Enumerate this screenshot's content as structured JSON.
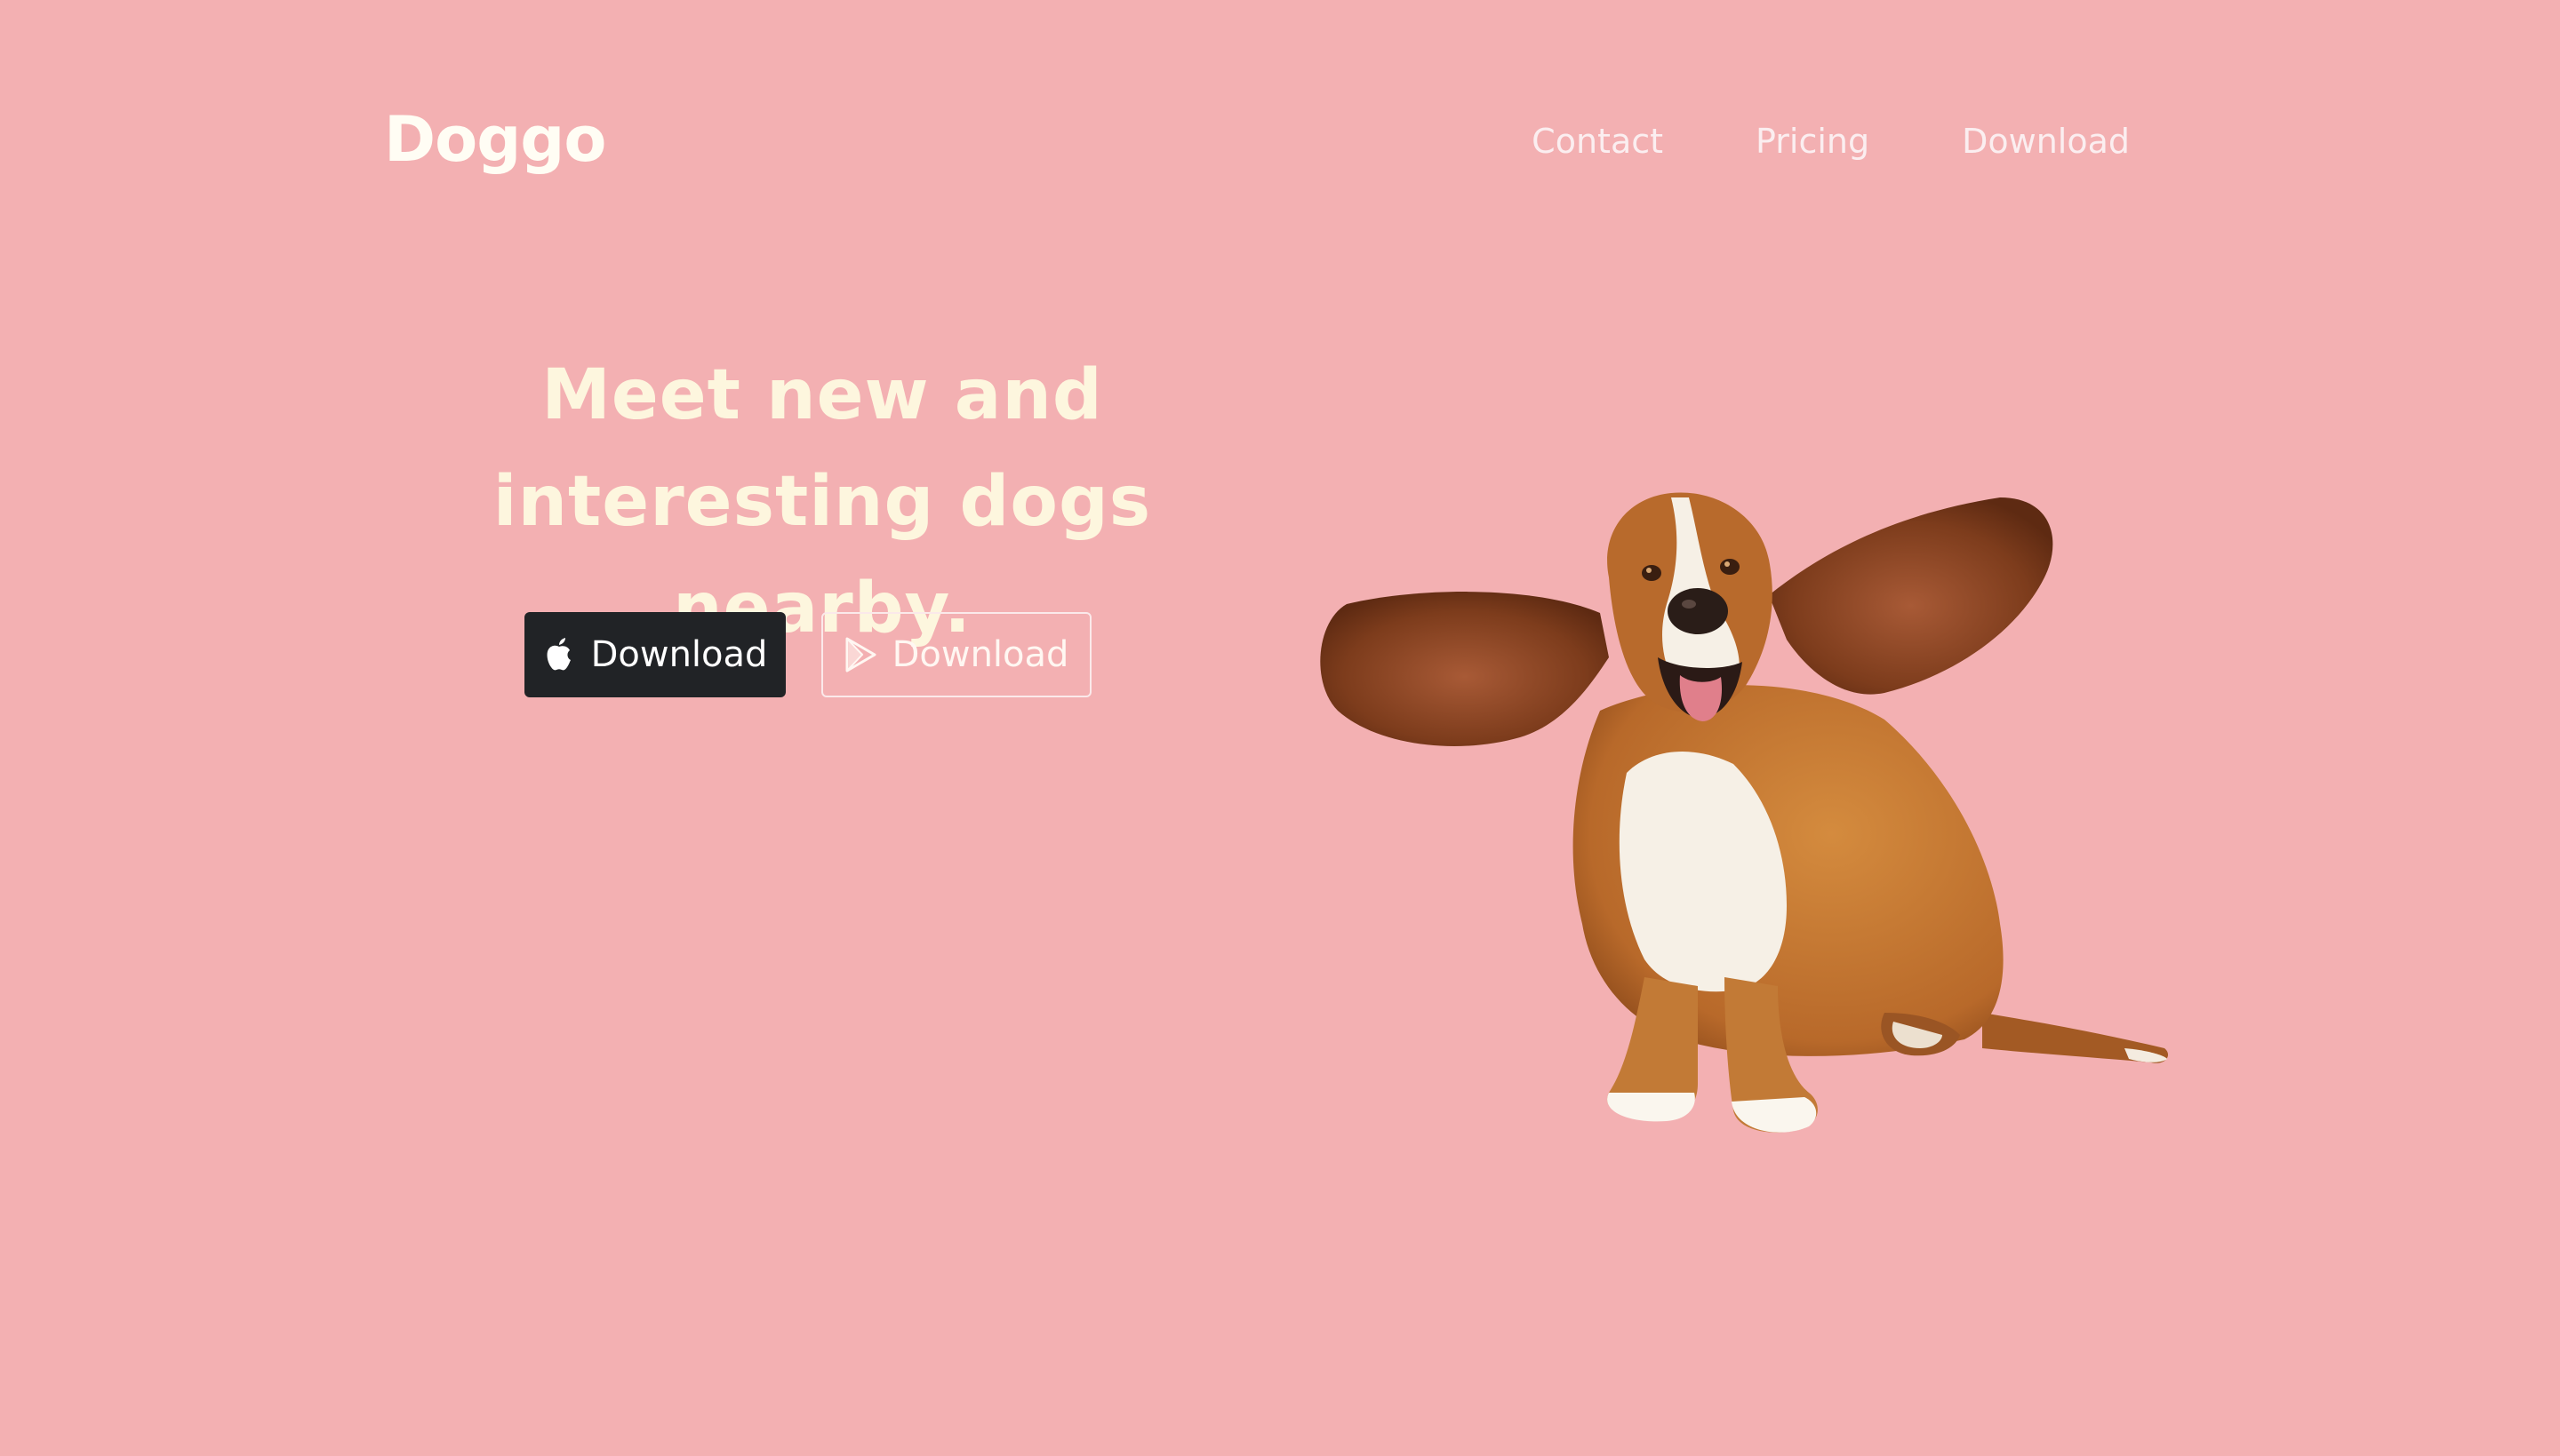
{
  "brand": {
    "logo_text": "Doggo"
  },
  "nav": {
    "items": [
      {
        "label": "Contact"
      },
      {
        "label": "Pricing"
      },
      {
        "label": "Download"
      }
    ]
  },
  "hero": {
    "title": "Meet new and interesting dogs nearby.",
    "buttons": {
      "apple": {
        "label": "Download",
        "icon": "apple-icon"
      },
      "play": {
        "label": "Download",
        "icon": "google-play-icon"
      }
    }
  },
  "image": {
    "subject": "basset-hound-dog"
  },
  "colors": {
    "background": "#f3b0b2",
    "title": "#fdf6de",
    "primary_button": "#212326"
  }
}
